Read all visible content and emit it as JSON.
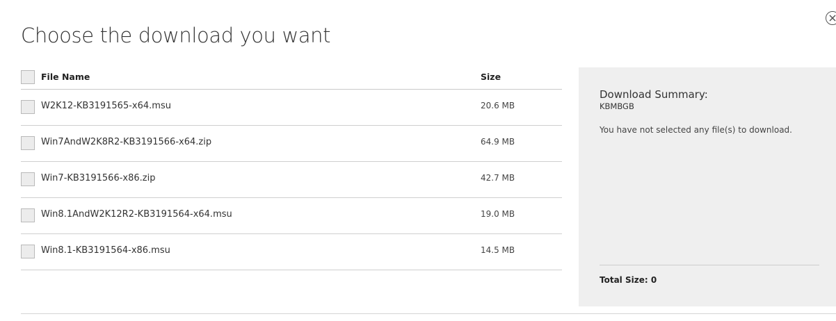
{
  "dialog": {
    "title": "Choose the download you want"
  },
  "table": {
    "header": {
      "name": "File Name",
      "size": "Size"
    },
    "rows": [
      {
        "name": "W2K12-KB3191565-x64.msu",
        "size": "20.6 MB"
      },
      {
        "name": "Win7AndW2K8R2-KB3191566-x64.zip",
        "size": "64.9 MB"
      },
      {
        "name": "Win7-KB3191566-x86.zip",
        "size": "42.7 MB"
      },
      {
        "name": "Win8.1AndW2K12R2-KB3191564-x64.msu",
        "size": "19.0 MB"
      },
      {
        "name": "Win8.1-KB3191564-x86.msu",
        "size": "14.5 MB"
      }
    ]
  },
  "summary": {
    "heading": "Download Summary:",
    "code": "KBMBGB",
    "message": "You have not selected any file(s) to download.",
    "total_size": "Total Size: 0"
  },
  "icons": {
    "close": "close-circle-icon"
  }
}
